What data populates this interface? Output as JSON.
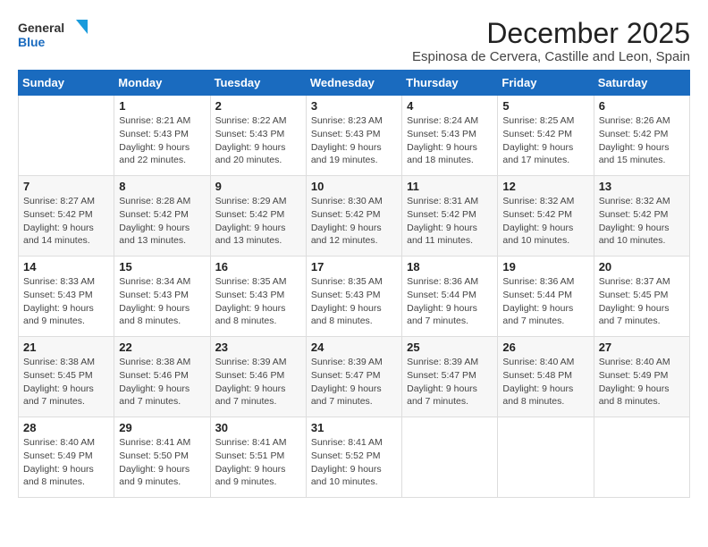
{
  "logo": {
    "line1": "General",
    "line2": "Blue"
  },
  "title": "December 2025",
  "subtitle": "Espinosa de Cervera, Castille and Leon, Spain",
  "days_of_week": [
    "Sunday",
    "Monday",
    "Tuesday",
    "Wednesday",
    "Thursday",
    "Friday",
    "Saturday"
  ],
  "weeks": [
    [
      {
        "day": "",
        "sunrise": "",
        "sunset": "",
        "daylight": ""
      },
      {
        "day": "1",
        "sunrise": "Sunrise: 8:21 AM",
        "sunset": "Sunset: 5:43 PM",
        "daylight": "Daylight: 9 hours and 22 minutes."
      },
      {
        "day": "2",
        "sunrise": "Sunrise: 8:22 AM",
        "sunset": "Sunset: 5:43 PM",
        "daylight": "Daylight: 9 hours and 20 minutes."
      },
      {
        "day": "3",
        "sunrise": "Sunrise: 8:23 AM",
        "sunset": "Sunset: 5:43 PM",
        "daylight": "Daylight: 9 hours and 19 minutes."
      },
      {
        "day": "4",
        "sunrise": "Sunrise: 8:24 AM",
        "sunset": "Sunset: 5:43 PM",
        "daylight": "Daylight: 9 hours and 18 minutes."
      },
      {
        "day": "5",
        "sunrise": "Sunrise: 8:25 AM",
        "sunset": "Sunset: 5:42 PM",
        "daylight": "Daylight: 9 hours and 17 minutes."
      },
      {
        "day": "6",
        "sunrise": "Sunrise: 8:26 AM",
        "sunset": "Sunset: 5:42 PM",
        "daylight": "Daylight: 9 hours and 15 minutes."
      }
    ],
    [
      {
        "day": "7",
        "sunrise": "Sunrise: 8:27 AM",
        "sunset": "Sunset: 5:42 PM",
        "daylight": "Daylight: 9 hours and 14 minutes."
      },
      {
        "day": "8",
        "sunrise": "Sunrise: 8:28 AM",
        "sunset": "Sunset: 5:42 PM",
        "daylight": "Daylight: 9 hours and 13 minutes."
      },
      {
        "day": "9",
        "sunrise": "Sunrise: 8:29 AM",
        "sunset": "Sunset: 5:42 PM",
        "daylight": "Daylight: 9 hours and 13 minutes."
      },
      {
        "day": "10",
        "sunrise": "Sunrise: 8:30 AM",
        "sunset": "Sunset: 5:42 PM",
        "daylight": "Daylight: 9 hours and 12 minutes."
      },
      {
        "day": "11",
        "sunrise": "Sunrise: 8:31 AM",
        "sunset": "Sunset: 5:42 PM",
        "daylight": "Daylight: 9 hours and 11 minutes."
      },
      {
        "day": "12",
        "sunrise": "Sunrise: 8:32 AM",
        "sunset": "Sunset: 5:42 PM",
        "daylight": "Daylight: 9 hours and 10 minutes."
      },
      {
        "day": "13",
        "sunrise": "Sunrise: 8:32 AM",
        "sunset": "Sunset: 5:42 PM",
        "daylight": "Daylight: 9 hours and 10 minutes."
      }
    ],
    [
      {
        "day": "14",
        "sunrise": "Sunrise: 8:33 AM",
        "sunset": "Sunset: 5:43 PM",
        "daylight": "Daylight: 9 hours and 9 minutes."
      },
      {
        "day": "15",
        "sunrise": "Sunrise: 8:34 AM",
        "sunset": "Sunset: 5:43 PM",
        "daylight": "Daylight: 9 hours and 8 minutes."
      },
      {
        "day": "16",
        "sunrise": "Sunrise: 8:35 AM",
        "sunset": "Sunset: 5:43 PM",
        "daylight": "Daylight: 9 hours and 8 minutes."
      },
      {
        "day": "17",
        "sunrise": "Sunrise: 8:35 AM",
        "sunset": "Sunset: 5:43 PM",
        "daylight": "Daylight: 9 hours and 8 minutes."
      },
      {
        "day": "18",
        "sunrise": "Sunrise: 8:36 AM",
        "sunset": "Sunset: 5:44 PM",
        "daylight": "Daylight: 9 hours and 7 minutes."
      },
      {
        "day": "19",
        "sunrise": "Sunrise: 8:36 AM",
        "sunset": "Sunset: 5:44 PM",
        "daylight": "Daylight: 9 hours and 7 minutes."
      },
      {
        "day": "20",
        "sunrise": "Sunrise: 8:37 AM",
        "sunset": "Sunset: 5:45 PM",
        "daylight": "Daylight: 9 hours and 7 minutes."
      }
    ],
    [
      {
        "day": "21",
        "sunrise": "Sunrise: 8:38 AM",
        "sunset": "Sunset: 5:45 PM",
        "daylight": "Daylight: 9 hours and 7 minutes."
      },
      {
        "day": "22",
        "sunrise": "Sunrise: 8:38 AM",
        "sunset": "Sunset: 5:46 PM",
        "daylight": "Daylight: 9 hours and 7 minutes."
      },
      {
        "day": "23",
        "sunrise": "Sunrise: 8:39 AM",
        "sunset": "Sunset: 5:46 PM",
        "daylight": "Daylight: 9 hours and 7 minutes."
      },
      {
        "day": "24",
        "sunrise": "Sunrise: 8:39 AM",
        "sunset": "Sunset: 5:47 PM",
        "daylight": "Daylight: 9 hours and 7 minutes."
      },
      {
        "day": "25",
        "sunrise": "Sunrise: 8:39 AM",
        "sunset": "Sunset: 5:47 PM",
        "daylight": "Daylight: 9 hours and 7 minutes."
      },
      {
        "day": "26",
        "sunrise": "Sunrise: 8:40 AM",
        "sunset": "Sunset: 5:48 PM",
        "daylight": "Daylight: 9 hours and 8 minutes."
      },
      {
        "day": "27",
        "sunrise": "Sunrise: 8:40 AM",
        "sunset": "Sunset: 5:49 PM",
        "daylight": "Daylight: 9 hours and 8 minutes."
      }
    ],
    [
      {
        "day": "28",
        "sunrise": "Sunrise: 8:40 AM",
        "sunset": "Sunset: 5:49 PM",
        "daylight": "Daylight: 9 hours and 8 minutes."
      },
      {
        "day": "29",
        "sunrise": "Sunrise: 8:41 AM",
        "sunset": "Sunset: 5:50 PM",
        "daylight": "Daylight: 9 hours and 9 minutes."
      },
      {
        "day": "30",
        "sunrise": "Sunrise: 8:41 AM",
        "sunset": "Sunset: 5:51 PM",
        "daylight": "Daylight: 9 hours and 9 minutes."
      },
      {
        "day": "31",
        "sunrise": "Sunrise: 8:41 AM",
        "sunset": "Sunset: 5:52 PM",
        "daylight": "Daylight: 9 hours and 10 minutes."
      },
      {
        "day": "",
        "sunrise": "",
        "sunset": "",
        "daylight": ""
      },
      {
        "day": "",
        "sunrise": "",
        "sunset": "",
        "daylight": ""
      },
      {
        "day": "",
        "sunrise": "",
        "sunset": "",
        "daylight": ""
      }
    ]
  ]
}
